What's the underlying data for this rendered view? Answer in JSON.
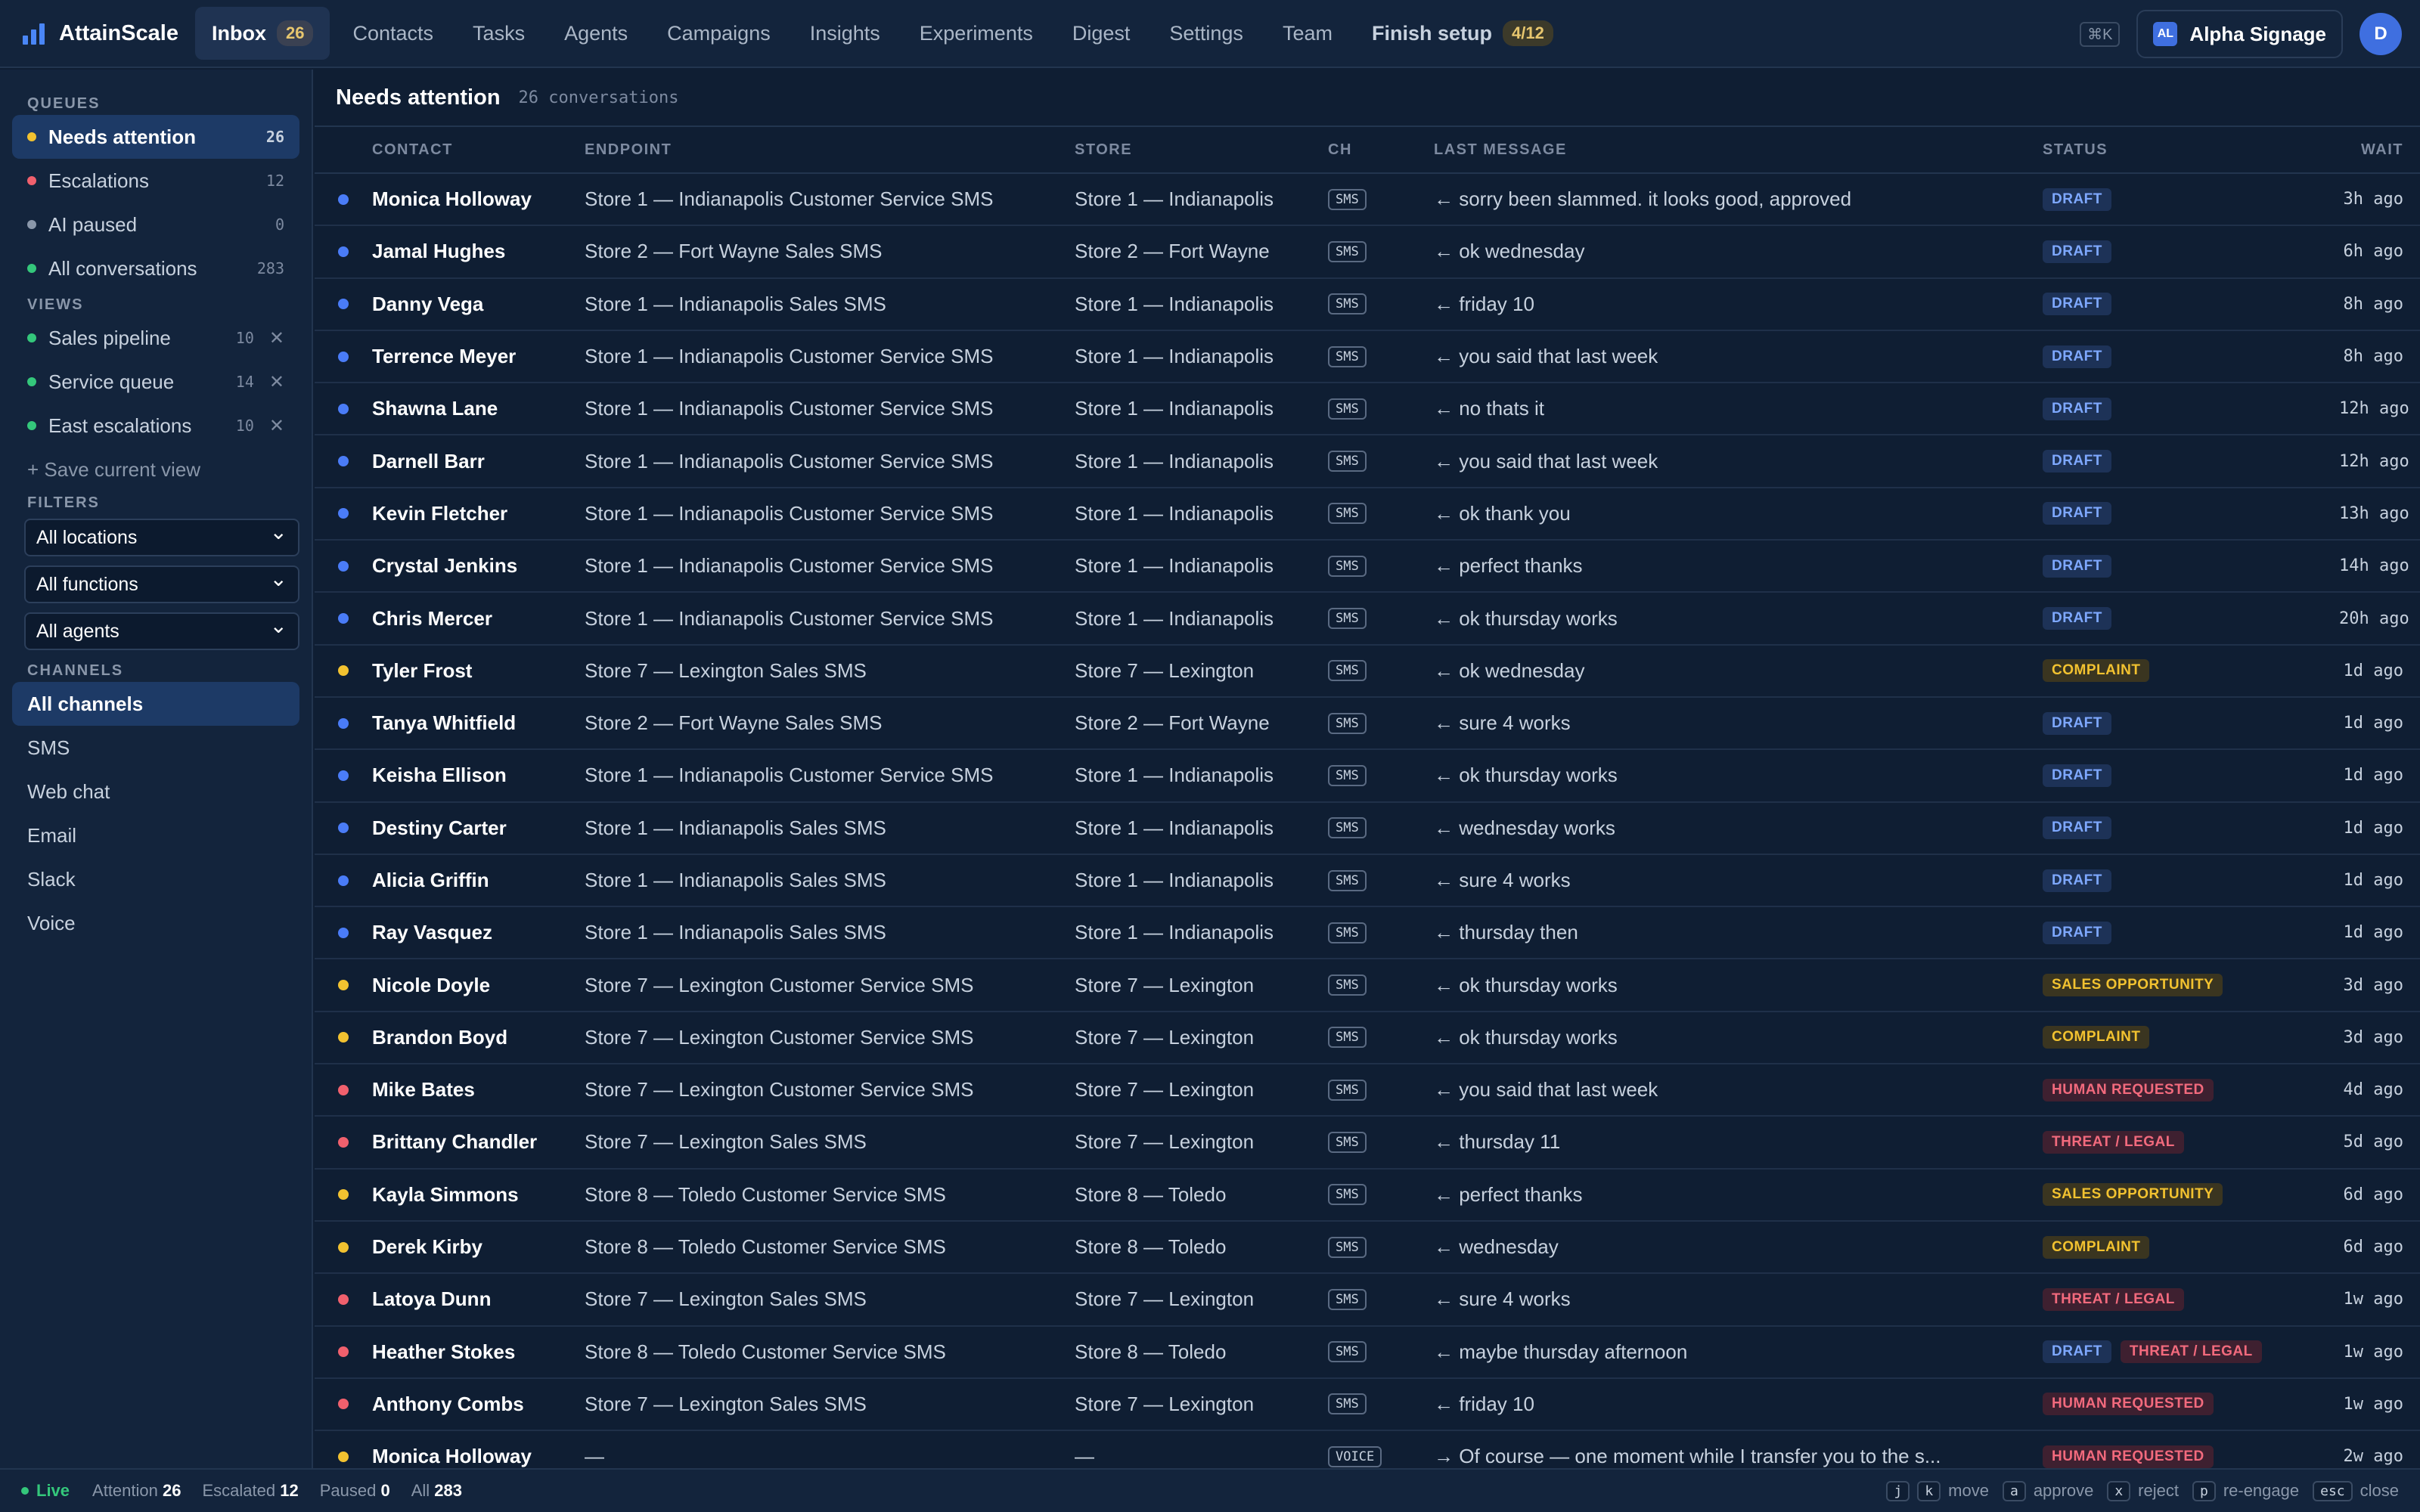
{
  "nav": {
    "brand": "AttainScale",
    "tabs": [
      {
        "label": "Inbox",
        "count": "26",
        "active": true
      },
      {
        "label": "Contacts"
      },
      {
        "label": "Tasks"
      },
      {
        "label": "Agents"
      },
      {
        "label": "Campaigns"
      },
      {
        "label": "Insights"
      },
      {
        "label": "Experiments"
      },
      {
        "label": "Digest"
      },
      {
        "label": "Settings"
      },
      {
        "label": "Team"
      }
    ],
    "setup_label": "Finish setup",
    "setup_progress": "4/12",
    "cmd_hint": "⌘K",
    "org_initials": "AL",
    "org_name": "Alpha Signage",
    "avatar_initial": "D"
  },
  "sidebar": {
    "queues_title": "QUEUES",
    "queues": [
      {
        "label": "Needs attention",
        "count": "26",
        "color": "#f2c230",
        "active": true
      },
      {
        "label": "Escalations",
        "count": "12",
        "color": "#f0606d"
      },
      {
        "label": "AI paused",
        "count": "0",
        "color": "#8a97aa"
      },
      {
        "label": "All conversations",
        "count": "283",
        "color": "#34c77b"
      }
    ],
    "views_title": "VIEWS",
    "views": [
      {
        "label": "Sales pipeline",
        "count": "10",
        "color": "#34c77b"
      },
      {
        "label": "Service queue",
        "count": "14",
        "color": "#34c77b"
      },
      {
        "label": "East escalations",
        "count": "10",
        "color": "#34c77b"
      }
    ],
    "save_view": "+ Save current view",
    "filters_title": "FILTERS",
    "filters": [
      "All locations",
      "All functions",
      "All agents"
    ],
    "channels_title": "CHANNELS",
    "channels": [
      {
        "label": "All channels",
        "active": true
      },
      {
        "label": "SMS"
      },
      {
        "label": "Web chat"
      },
      {
        "label": "Email"
      },
      {
        "label": "Slack"
      },
      {
        "label": "Voice"
      }
    ]
  },
  "main": {
    "title": "Needs attention",
    "subtitle": "26 conversations",
    "columns": [
      "CONTACT",
      "ENDPOINT",
      "STORE",
      "CH",
      "LAST MESSAGE",
      "STATUS",
      "WAIT"
    ],
    "rows": [
      {
        "dot": "#4a7cf7",
        "contact": "Monica Holloway",
        "endpoint": "Store 1 — Indianapolis Customer Service SMS",
        "store": "Store 1 — Indianapolis",
        "ch": "SMS",
        "message": "← sorry been slammed. it looks good, approved",
        "status": [
          {
            "label": "DRAFT",
            "kind": "draft"
          }
        ],
        "wait": "3h ago"
      },
      {
        "dot": "#4a7cf7",
        "contact": "Jamal Hughes",
        "endpoint": "Store 2 — Fort Wayne Sales SMS",
        "store": "Store 2 — Fort Wayne",
        "ch": "SMS",
        "message": "← ok wednesday",
        "status": [
          {
            "label": "DRAFT",
            "kind": "draft"
          }
        ],
        "wait": "6h ago"
      },
      {
        "dot": "#4a7cf7",
        "contact": "Danny Vega",
        "endpoint": "Store 1 — Indianapolis Sales SMS",
        "store": "Store 1 — Indianapolis",
        "ch": "SMS",
        "message": "← friday 10",
        "status": [
          {
            "label": "DRAFT",
            "kind": "draft"
          }
        ],
        "wait": "8h ago"
      },
      {
        "dot": "#4a7cf7",
        "contact": "Terrence Meyer",
        "endpoint": "Store 1 — Indianapolis Customer Service SMS",
        "store": "Store 1 — Indianapolis",
        "ch": "SMS",
        "message": "← you said that last week",
        "status": [
          {
            "label": "DRAFT",
            "kind": "draft"
          }
        ],
        "wait": "8h ago"
      },
      {
        "dot": "#4a7cf7",
        "contact": "Shawna Lane",
        "endpoint": "Store 1 — Indianapolis Customer Service SMS",
        "store": "Store 1 — Indianapolis",
        "ch": "SMS",
        "message": "← no thats it",
        "status": [
          {
            "label": "DRAFT",
            "kind": "draft"
          }
        ],
        "wait": "12h ago"
      },
      {
        "dot": "#4a7cf7",
        "contact": "Darnell Barr",
        "endpoint": "Store 1 — Indianapolis Customer Service SMS",
        "store": "Store 1 — Indianapolis",
        "ch": "SMS",
        "message": "← you said that last week",
        "status": [
          {
            "label": "DRAFT",
            "kind": "draft"
          }
        ],
        "wait": "12h ago"
      },
      {
        "dot": "#4a7cf7",
        "contact": "Kevin Fletcher",
        "endpoint": "Store 1 — Indianapolis Customer Service SMS",
        "store": "Store 1 — Indianapolis",
        "ch": "SMS",
        "message": "← ok thank you",
        "status": [
          {
            "label": "DRAFT",
            "kind": "draft"
          }
        ],
        "wait": "13h ago"
      },
      {
        "dot": "#4a7cf7",
        "contact": "Crystal Jenkins",
        "endpoint": "Store 1 — Indianapolis Customer Service SMS",
        "store": "Store 1 — Indianapolis",
        "ch": "SMS",
        "message": "← perfect thanks",
        "status": [
          {
            "label": "DRAFT",
            "kind": "draft"
          }
        ],
        "wait": "14h ago"
      },
      {
        "dot": "#4a7cf7",
        "contact": "Chris Mercer",
        "endpoint": "Store 1 — Indianapolis Customer Service SMS",
        "store": "Store 1 — Indianapolis",
        "ch": "SMS",
        "message": "← ok thursday works",
        "status": [
          {
            "label": "DRAFT",
            "kind": "draft"
          }
        ],
        "wait": "20h ago"
      },
      {
        "dot": "#f2c230",
        "contact": "Tyler Frost",
        "endpoint": "Store 7 — Lexington Sales SMS",
        "store": "Store 7 — Lexington",
        "ch": "SMS",
        "message": "← ok wednesday",
        "status": [
          {
            "label": "COMPLAINT",
            "kind": "complaint"
          }
        ],
        "wait": "1d ago"
      },
      {
        "dot": "#4a7cf7",
        "contact": "Tanya Whitfield",
        "endpoint": "Store 2 — Fort Wayne Sales SMS",
        "store": "Store 2 — Fort Wayne",
        "ch": "SMS",
        "message": "← sure 4 works",
        "status": [
          {
            "label": "DRAFT",
            "kind": "draft"
          }
        ],
        "wait": "1d ago"
      },
      {
        "dot": "#4a7cf7",
        "contact": "Keisha Ellison",
        "endpoint": "Store 1 — Indianapolis Customer Service SMS",
        "store": "Store 1 — Indianapolis",
        "ch": "SMS",
        "message": "← ok thursday works",
        "status": [
          {
            "label": "DRAFT",
            "kind": "draft"
          }
        ],
        "wait": "1d ago"
      },
      {
        "dot": "#4a7cf7",
        "contact": "Destiny Carter",
        "endpoint": "Store 1 — Indianapolis Sales SMS",
        "store": "Store 1 — Indianapolis",
        "ch": "SMS",
        "message": "← wednesday works",
        "status": [
          {
            "label": "DRAFT",
            "kind": "draft"
          }
        ],
        "wait": "1d ago"
      },
      {
        "dot": "#4a7cf7",
        "contact": "Alicia Griffin",
        "endpoint": "Store 1 — Indianapolis Sales SMS",
        "store": "Store 1 — Indianapolis",
        "ch": "SMS",
        "message": "← sure 4 works",
        "status": [
          {
            "label": "DRAFT",
            "kind": "draft"
          }
        ],
        "wait": "1d ago"
      },
      {
        "dot": "#4a7cf7",
        "contact": "Ray Vasquez",
        "endpoint": "Store 1 — Indianapolis Sales SMS",
        "store": "Store 1 — Indianapolis",
        "ch": "SMS",
        "message": "← thursday then",
        "status": [
          {
            "label": "DRAFT",
            "kind": "draft"
          }
        ],
        "wait": "1d ago"
      },
      {
        "dot": "#f2c230",
        "contact": "Nicole Doyle",
        "endpoint": "Store 7 — Lexington Customer Service SMS",
        "store": "Store 7 — Lexington",
        "ch": "SMS",
        "message": "← ok thursday works",
        "status": [
          {
            "label": "SALES OPPORTUNITY",
            "kind": "sales"
          }
        ],
        "wait": "3d ago"
      },
      {
        "dot": "#f2c230",
        "contact": "Brandon Boyd",
        "endpoint": "Store 7 — Lexington Customer Service SMS",
        "store": "Store 7 — Lexington",
        "ch": "SMS",
        "message": "← ok thursday works",
        "status": [
          {
            "label": "COMPLAINT",
            "kind": "complaint"
          }
        ],
        "wait": "3d ago"
      },
      {
        "dot": "#f0606d",
        "contact": "Mike Bates",
        "endpoint": "Store 7 — Lexington Customer Service SMS",
        "store": "Store 7 — Lexington",
        "ch": "SMS",
        "message": "← you said that last week",
        "status": [
          {
            "label": "HUMAN REQUESTED",
            "kind": "human"
          }
        ],
        "wait": "4d ago"
      },
      {
        "dot": "#f0606d",
        "contact": "Brittany Chandler",
        "endpoint": "Store 7 — Lexington Sales SMS",
        "store": "Store 7 — Lexington",
        "ch": "SMS",
        "message": "← thursday 11",
        "status": [
          {
            "label": "THREAT / LEGAL",
            "kind": "threat"
          }
        ],
        "wait": "5d ago"
      },
      {
        "dot": "#f2c230",
        "contact": "Kayla Simmons",
        "endpoint": "Store 8 — Toledo Customer Service SMS",
        "store": "Store 8 — Toledo",
        "ch": "SMS",
        "message": "← perfect thanks",
        "status": [
          {
            "label": "SALES OPPORTUNITY",
            "kind": "sales"
          }
        ],
        "wait": "6d ago"
      },
      {
        "dot": "#f2c230",
        "contact": "Derek Kirby",
        "endpoint": "Store 8 — Toledo Customer Service SMS",
        "store": "Store 8 — Toledo",
        "ch": "SMS",
        "message": "← wednesday",
        "status": [
          {
            "label": "COMPLAINT",
            "kind": "complaint"
          }
        ],
        "wait": "6d ago"
      },
      {
        "dot": "#f0606d",
        "contact": "Latoya Dunn",
        "endpoint": "Store 7 — Lexington Sales SMS",
        "store": "Store 7 — Lexington",
        "ch": "SMS",
        "message": "← sure 4 works",
        "status": [
          {
            "label": "THREAT / LEGAL",
            "kind": "threat"
          }
        ],
        "wait": "1w ago"
      },
      {
        "dot": "#f0606d",
        "contact": "Heather Stokes",
        "endpoint": "Store 8 — Toledo Customer Service SMS",
        "store": "Store 8 — Toledo",
        "ch": "SMS",
        "message": "← maybe thursday afternoon",
        "status": [
          {
            "label": "DRAFT",
            "kind": "draft"
          },
          {
            "label": "THREAT / LEGAL",
            "kind": "threat"
          }
        ],
        "wait": "1w ago"
      },
      {
        "dot": "#f0606d",
        "contact": "Anthony Combs",
        "endpoint": "Store 7 — Lexington Sales SMS",
        "store": "Store 7 — Lexington",
        "ch": "SMS",
        "message": "← friday 10",
        "status": [
          {
            "label": "HUMAN REQUESTED",
            "kind": "human"
          }
        ],
        "wait": "1w ago"
      },
      {
        "dot": "#f2c230",
        "contact": "Monica Holloway",
        "endpoint": "—",
        "store": "—",
        "ch": "VOICE",
        "message": "→ Of course — one moment while I transfer you to the s...",
        "status": [
          {
            "label": "HUMAN REQUESTED",
            "kind": "human"
          }
        ],
        "wait": "2w ago"
      }
    ]
  },
  "footer": {
    "live": "Live",
    "stats": [
      {
        "label": "Attention",
        "value": "26"
      },
      {
        "label": "Escalated",
        "value": "12"
      },
      {
        "label": "Paused",
        "value": "0"
      },
      {
        "label": "All",
        "value": "283"
      }
    ],
    "hints": [
      {
        "keys": [
          "j",
          "k"
        ],
        "label": "move"
      },
      {
        "keys": [
          "a"
        ],
        "label": "approve"
      },
      {
        "keys": [
          "x"
        ],
        "label": "reject"
      },
      {
        "keys": [
          "p"
        ],
        "label": "re-engage"
      },
      {
        "keys": [
          "esc"
        ],
        "label": "close"
      }
    ]
  }
}
